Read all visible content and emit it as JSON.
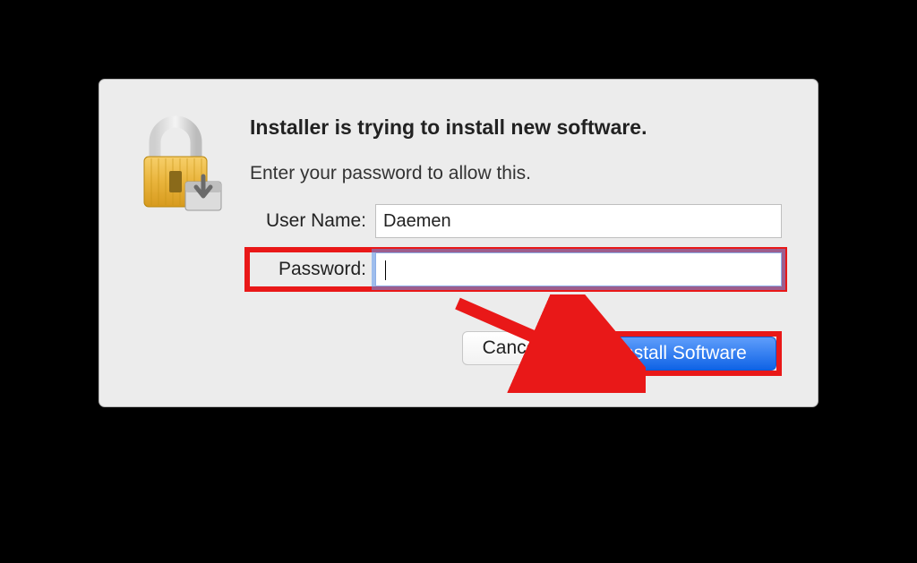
{
  "dialog": {
    "heading": "Installer is trying to install new software.",
    "subtext": "Enter your password to allow this.",
    "username_label": "User Name:",
    "username_value": "Daemen",
    "password_label": "Password:",
    "password_value": "",
    "cancel_label": "Cancel",
    "confirm_label": "Install Software"
  },
  "annotation": {
    "highlight_color": "#e91818"
  }
}
